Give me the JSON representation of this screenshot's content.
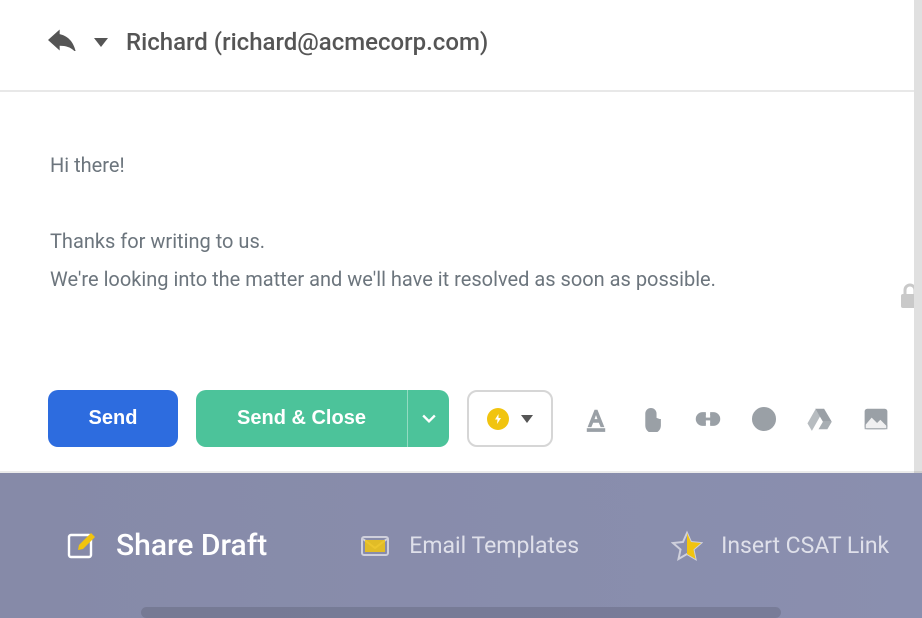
{
  "header": {
    "recipient": "Richard (richard@acmecorp.com)"
  },
  "body": {
    "line1": "Hi there!",
    "line2": "Thanks for writing to us.",
    "line3": "We're looking into the matter and we'll have it resolved as soon as possible."
  },
  "toolbar": {
    "send_label": "Send",
    "send_close_label": "Send & Close"
  },
  "bottombar": {
    "share_label": "Share Draft",
    "templates_label": "Email Templates",
    "csat_label": "Insert CSAT Link"
  }
}
